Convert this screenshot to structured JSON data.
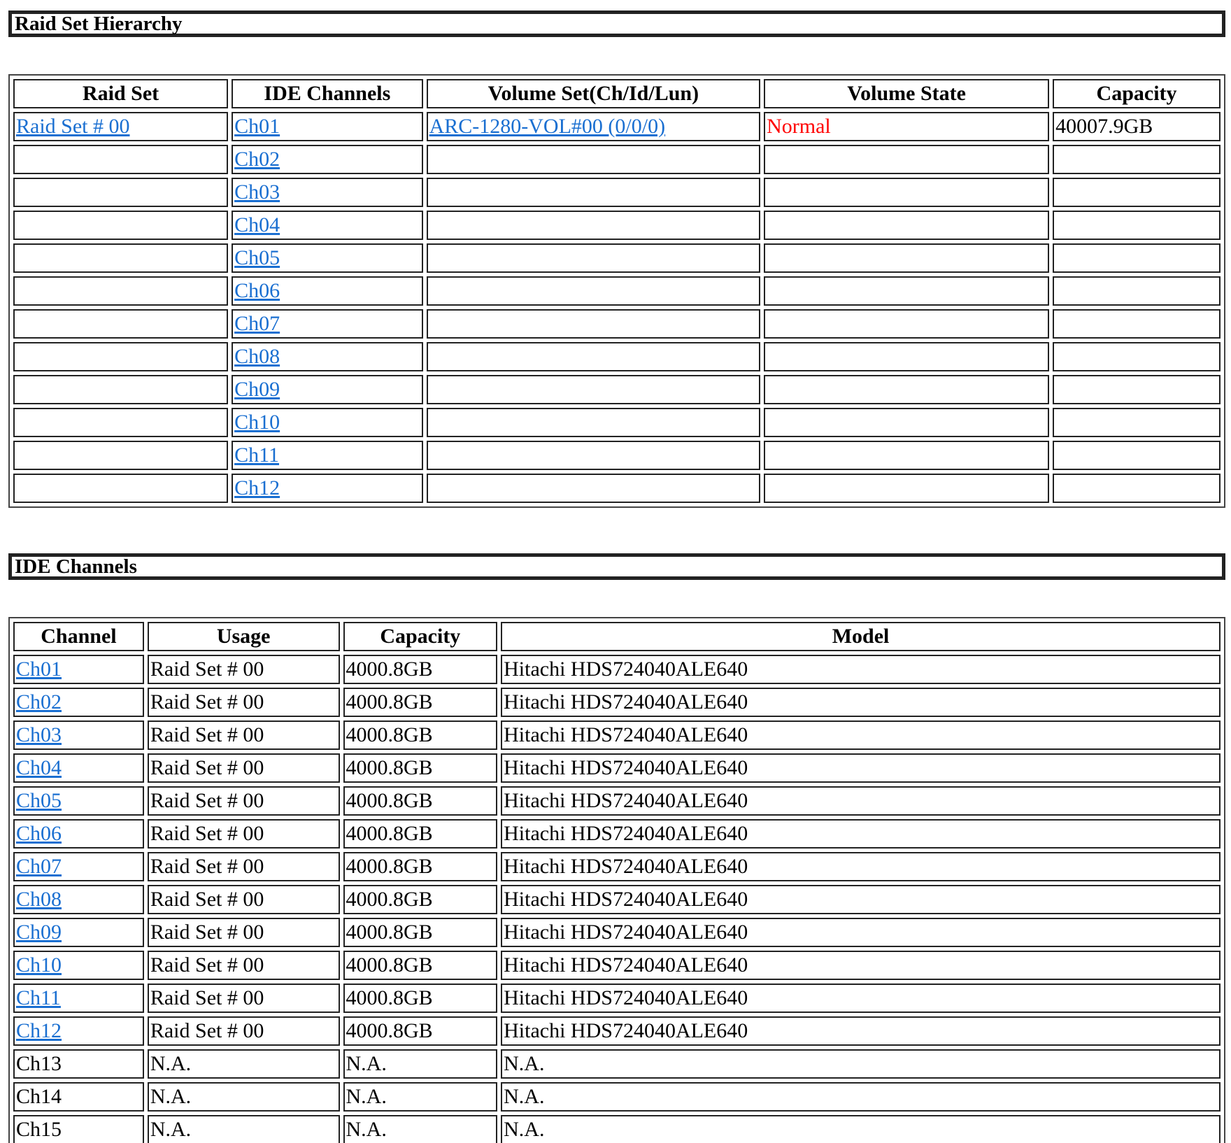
{
  "raid_section": {
    "title": "Raid Set Hierarchy",
    "headers": [
      "Raid Set",
      "IDE Channels",
      "Volume Set(Ch/Id/Lun)",
      "Volume State",
      "Capacity"
    ],
    "rows": [
      {
        "raid_set": "Raid Set # 00",
        "channel": "Ch01",
        "volume_set": "ARC-1280-VOL#00 (0/0/0)",
        "volume_state": "Normal",
        "capacity": "40007.9GB"
      },
      {
        "raid_set": "",
        "channel": "Ch02",
        "volume_set": "",
        "volume_state": "",
        "capacity": ""
      },
      {
        "raid_set": "",
        "channel": "Ch03",
        "volume_set": "",
        "volume_state": "",
        "capacity": ""
      },
      {
        "raid_set": "",
        "channel": "Ch04",
        "volume_set": "",
        "volume_state": "",
        "capacity": ""
      },
      {
        "raid_set": "",
        "channel": "Ch05",
        "volume_set": "",
        "volume_state": "",
        "capacity": ""
      },
      {
        "raid_set": "",
        "channel": "Ch06",
        "volume_set": "",
        "volume_state": "",
        "capacity": ""
      },
      {
        "raid_set": "",
        "channel": "Ch07",
        "volume_set": "",
        "volume_state": "",
        "capacity": ""
      },
      {
        "raid_set": "",
        "channel": "Ch08",
        "volume_set": "",
        "volume_state": "",
        "capacity": ""
      },
      {
        "raid_set": "",
        "channel": "Ch09",
        "volume_set": "",
        "volume_state": "",
        "capacity": ""
      },
      {
        "raid_set": "",
        "channel": "Ch10",
        "volume_set": "",
        "volume_state": "",
        "capacity": ""
      },
      {
        "raid_set": "",
        "channel": "Ch11",
        "volume_set": "",
        "volume_state": "",
        "capacity": ""
      },
      {
        "raid_set": "",
        "channel": "Ch12",
        "volume_set": "",
        "volume_state": "",
        "capacity": ""
      }
    ]
  },
  "ide_section": {
    "title": "IDE Channels",
    "headers": [
      "Channel",
      "Usage",
      "Capacity",
      "Model"
    ],
    "rows": [
      {
        "channel": "Ch01",
        "linked": true,
        "usage": "Raid Set # 00",
        "capacity": "4000.8GB",
        "model": "Hitachi HDS724040ALE640"
      },
      {
        "channel": "Ch02",
        "linked": true,
        "usage": "Raid Set # 00",
        "capacity": "4000.8GB",
        "model": "Hitachi HDS724040ALE640"
      },
      {
        "channel": "Ch03",
        "linked": true,
        "usage": "Raid Set # 00",
        "capacity": "4000.8GB",
        "model": "Hitachi HDS724040ALE640"
      },
      {
        "channel": "Ch04",
        "linked": true,
        "usage": "Raid Set # 00",
        "capacity": "4000.8GB",
        "model": "Hitachi HDS724040ALE640"
      },
      {
        "channel": "Ch05",
        "linked": true,
        "usage": "Raid Set # 00",
        "capacity": "4000.8GB",
        "model": "Hitachi HDS724040ALE640"
      },
      {
        "channel": "Ch06",
        "linked": true,
        "usage": "Raid Set # 00",
        "capacity": "4000.8GB",
        "model": "Hitachi HDS724040ALE640"
      },
      {
        "channel": "Ch07",
        "linked": true,
        "usage": "Raid Set # 00",
        "capacity": "4000.8GB",
        "model": "Hitachi HDS724040ALE640"
      },
      {
        "channel": "Ch08",
        "linked": true,
        "usage": "Raid Set # 00",
        "capacity": "4000.8GB",
        "model": "Hitachi HDS724040ALE640"
      },
      {
        "channel": "Ch09",
        "linked": true,
        "usage": "Raid Set # 00",
        "capacity": "4000.8GB",
        "model": "Hitachi HDS724040ALE640"
      },
      {
        "channel": "Ch10",
        "linked": true,
        "usage": "Raid Set # 00",
        "capacity": "4000.8GB",
        "model": "Hitachi HDS724040ALE640"
      },
      {
        "channel": "Ch11",
        "linked": true,
        "usage": "Raid Set # 00",
        "capacity": "4000.8GB",
        "model": "Hitachi HDS724040ALE640"
      },
      {
        "channel": "Ch12",
        "linked": true,
        "usage": "Raid Set # 00",
        "capacity": "4000.8GB",
        "model": "Hitachi HDS724040ALE640"
      },
      {
        "channel": "Ch13",
        "linked": false,
        "usage": "N.A.",
        "capacity": "N.A.",
        "model": "N.A."
      },
      {
        "channel": "Ch14",
        "linked": false,
        "usage": "N.A.",
        "capacity": "N.A.",
        "model": "N.A."
      },
      {
        "channel": "Ch15",
        "linked": false,
        "usage": "N.A.",
        "capacity": "N.A.",
        "model": "N.A."
      }
    ]
  },
  "colors": {
    "link": "#1a6fd1",
    "state_normal": "#ff0000",
    "border": "#222222"
  }
}
